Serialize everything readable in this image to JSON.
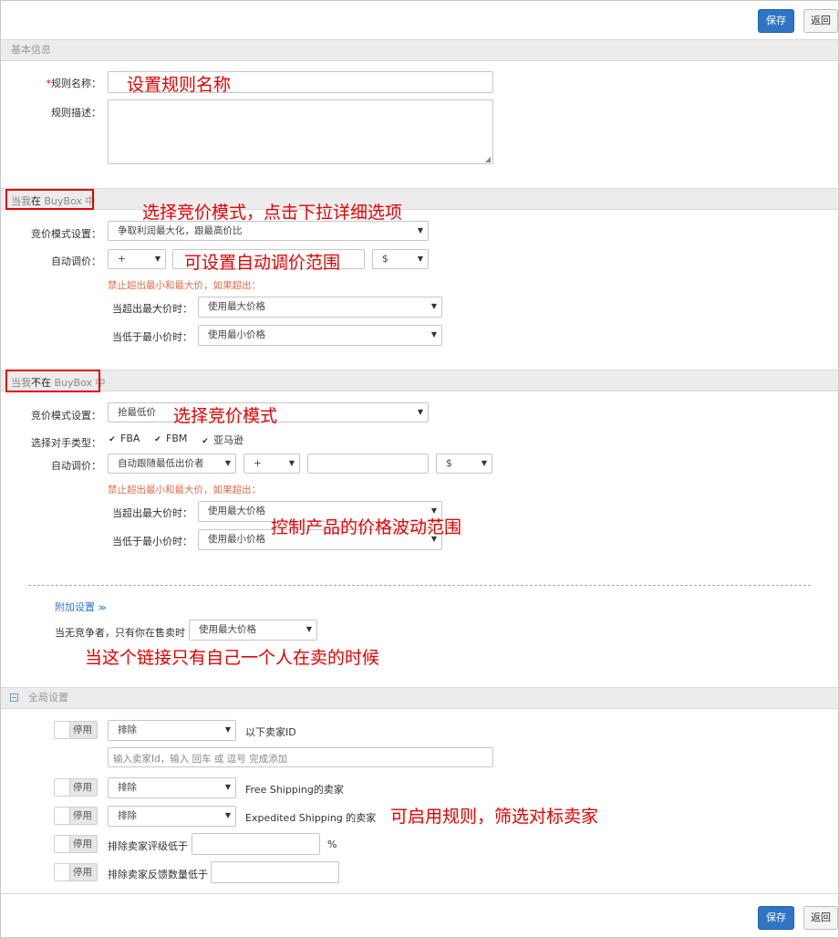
{
  "toolbar": {
    "save_label": "保存",
    "back_label": "返回"
  },
  "basic": {
    "section_title": "基本信息",
    "rule_name_required": "*",
    "rule_name_label": "规则名称：",
    "rule_name_value": "",
    "rule_desc_label": "规则描述：",
    "rule_desc_value": ""
  },
  "in_buybox": {
    "title_prefix": "当我",
    "title_emph": "在",
    "title_suffix": " BuyBox 中",
    "mode_label": "竞价模式设置：",
    "mode_value": "争取利润最大化，跟最高价比",
    "auto_label": "自动调价：",
    "auto_sign": "+",
    "auto_amount": "",
    "auto_unit": "$",
    "warning": "禁止超出最小和最大价，如果超出：",
    "over_max_label": "当超出最大价时：",
    "over_max_value": "使用最大价格",
    "below_min_label": "当低于最小价时：",
    "below_min_value": "使用最小价格"
  },
  "not_in_buybox": {
    "title_prefix": "当我",
    "title_emph": "不在",
    "title_suffix": " BuyBox 中",
    "mode_label": "竞价模式设置：",
    "mode_value": "抢最低价",
    "competitor_label": "选择对手类型：",
    "competitors": [
      {
        "label": "FBA",
        "checked": true
      },
      {
        "label": "FBM",
        "checked": true
      },
      {
        "label": "亚马逊",
        "checked": true
      }
    ],
    "auto_label": "自动调价：",
    "auto_strategy": "自动跟随最低出价者",
    "auto_sign": "+",
    "auto_amount": "",
    "auto_unit": "$",
    "warning": "禁止超出最小和最大价，如果超出：",
    "over_max_label": "当超出最大价时：",
    "over_max_value": "使用最大价格",
    "below_min_label": "当低于最小价时：",
    "below_min_value": "使用最小价格"
  },
  "extra": {
    "toggle_label": "附加设置",
    "toggle_icon": "double-chevron-down-icon",
    "no_competitor_label": "当无竞争者，只有你在售卖时",
    "no_competitor_value": "使用最大价格"
  },
  "global": {
    "section_title": "全局设置",
    "collapse_icon": "minus-square-icon",
    "rows": [
      {
        "toggle": "停用",
        "select": "排除",
        "text": "以下卖家ID",
        "input_placeholder": "输入卖家Id，输入 回车 或 逗号 完成添加"
      },
      {
        "toggle": "停用",
        "select": "排除",
        "text": "Free Shipping的卖家"
      },
      {
        "toggle": "停用",
        "select": "排除",
        "text": "Expedited Shipping 的卖家"
      },
      {
        "toggle": "停用",
        "text": "排除卖家评级低于",
        "suffix": "%"
      },
      {
        "toggle": "停用",
        "text": "排除卖家反馈数量低于"
      }
    ]
  },
  "annotations": {
    "a1": "设置规则名称",
    "a2": "选择竞价模式，点击下拉详细选项",
    "a3": "可设置自动调价范围",
    "a4": "选择竞价模式",
    "a5": "控制产品的价格波动范围",
    "a6": "当这个链接只有自己一个人在卖的时候",
    "a7": "可启用规则，筛选对标卖家"
  },
  "colors": {
    "primary": "#2e75c6",
    "annotation": "#e60000",
    "warning": "#e06c4c"
  }
}
